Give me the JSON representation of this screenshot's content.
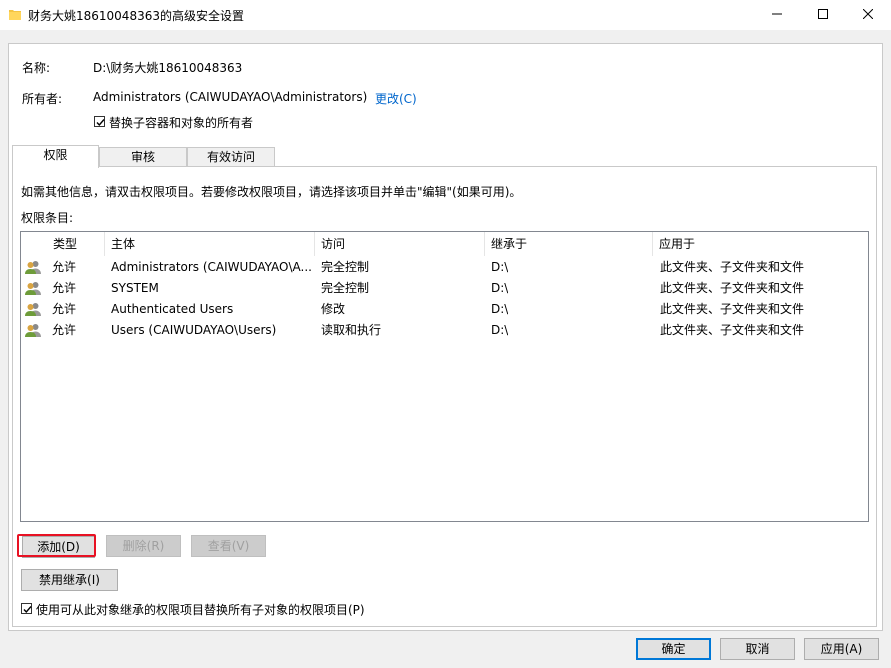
{
  "window": {
    "title": "财务大姚18610048363的高级安全设置",
    "minimize_icon": "minimize-icon",
    "maximize_icon": "maximize-icon",
    "close_icon": "close-icon"
  },
  "header": {
    "name_label": "名称:",
    "name_value": "D:\\财务大姚18610048363",
    "owner_label": "所有者:",
    "owner_value": "Administrators (CAIWUDAYAO\\Administrators)",
    "owner_change_link": "更改(C)",
    "replace_owner_checkbox": {
      "label": "替换子容器和对象的所有者",
      "checked": true
    }
  },
  "tabs": [
    {
      "label": "权限",
      "active": true
    },
    {
      "label": "审核",
      "active": false
    },
    {
      "label": "有效访问",
      "active": false
    }
  ],
  "permissions": {
    "info_text": "如需其他信息，请双击权限项目。若要修改权限项目，请选择该项目并单击\"编辑\"(如果可用)。",
    "entries_label": "权限条目:",
    "columns": [
      "类型",
      "主体",
      "访问",
      "继承于",
      "应用于"
    ],
    "rows": [
      {
        "type": "允许",
        "principal": "Administrators (CAIWUDAYAO\\A...",
        "access": "完全控制",
        "inherited_from": "D:\\",
        "applies_to": "此文件夹、子文件夹和文件"
      },
      {
        "type": "允许",
        "principal": "SYSTEM",
        "access": "完全控制",
        "inherited_from": "D:\\",
        "applies_to": "此文件夹、子文件夹和文件"
      },
      {
        "type": "允许",
        "principal": "Authenticated Users",
        "access": "修改",
        "inherited_from": "D:\\",
        "applies_to": "此文件夹、子文件夹和文件"
      },
      {
        "type": "允许",
        "principal": "Users (CAIWUDAYAO\\Users)",
        "access": "读取和执行",
        "inherited_from": "D:\\",
        "applies_to": "此文件夹、子文件夹和文件"
      }
    ],
    "row_icon": "users-group-icon",
    "add_button": "添加(D)",
    "remove_button": "删除(R)",
    "view_button": "查看(V)",
    "disable_inheritance_button": "禁用继承(I)",
    "replace_child_checkbox": {
      "label": "使用可从此对象继承的权限项目替换所有子对象的权限项目(P)",
      "checked": true
    }
  },
  "footer": {
    "ok_button": "确定",
    "cancel_button": "取消",
    "apply_button": "应用(A)"
  },
  "colors": {
    "highlight": "#e81123",
    "link": "#0066cc",
    "focus": "#0078d7"
  }
}
